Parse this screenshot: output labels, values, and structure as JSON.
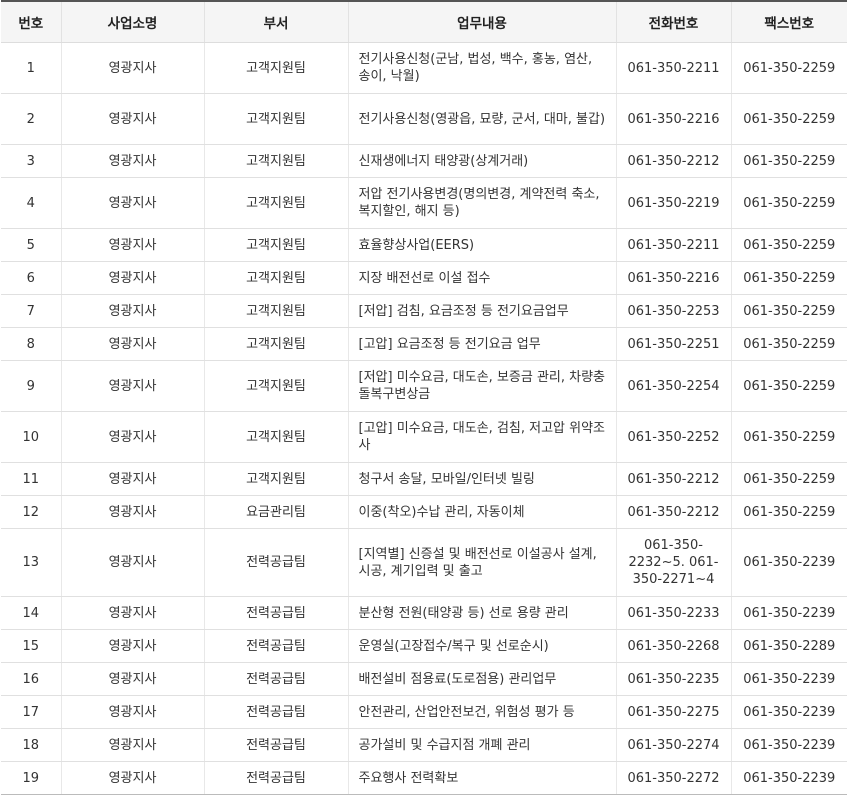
{
  "headers": [
    "번호",
    "사업소명",
    "부서",
    "업무내용",
    "전화번호",
    "팩스번호"
  ],
  "rows": [
    {
      "no": "1",
      "office": "영광지사",
      "dept": "고객지원팀",
      "duty": "전기사용신청(군남, 법성, 백수, 홍농, 염산, 송이, 낙월)",
      "phone": "061-350-2211",
      "fax": "061-350-2259"
    },
    {
      "no": "2",
      "office": "영광지사",
      "dept": "고객지원팀",
      "duty": "전기사용신청(영광읍, 묘량, 군서, 대마, 불갑)",
      "phone": "061-350-2216",
      "fax": "061-350-2259"
    },
    {
      "no": "3",
      "office": "영광지사",
      "dept": "고객지원팀",
      "duty": "신재생에너지 태양광(상계거래)",
      "phone": "061-350-2212",
      "fax": "061-350-2259"
    },
    {
      "no": "4",
      "office": "영광지사",
      "dept": "고객지원팀",
      "duty": "저압 전기사용변경(명의변경, 계약전력 축소, 복지할인, 해지 등)",
      "phone": "061-350-2219",
      "fax": "061-350-2259"
    },
    {
      "no": "5",
      "office": "영광지사",
      "dept": "고객지원팀",
      "duty": "효율향상사업(EERS)",
      "phone": "061-350-2211",
      "fax": "061-350-2259"
    },
    {
      "no": "6",
      "office": "영광지사",
      "dept": "고객지원팀",
      "duty": "지장 배전선로 이설 접수",
      "phone": "061-350-2216",
      "fax": "061-350-2259"
    },
    {
      "no": "7",
      "office": "영광지사",
      "dept": "고객지원팀",
      "duty": "[저압] 검침, 요금조정 등 전기요금업무",
      "phone": "061-350-2253",
      "fax": "061-350-2259"
    },
    {
      "no": "8",
      "office": "영광지사",
      "dept": "고객지원팀",
      "duty": "[고압] 요금조정 등 전기요금 업무",
      "phone": "061-350-2251",
      "fax": "061-350-2259"
    },
    {
      "no": "9",
      "office": "영광지사",
      "dept": "고객지원팀",
      "duty": "[저압] 미수요금, 대도손, 보증금 관리, 차량충돌복구변상금",
      "phone": "061-350-2254",
      "fax": "061-350-2259"
    },
    {
      "no": "10",
      "office": "영광지사",
      "dept": "고객지원팀",
      "duty": "[고압] 미수요금, 대도손, 검침, 저고압 위약조사",
      "phone": "061-350-2252",
      "fax": "061-350-2259"
    },
    {
      "no": "11",
      "office": "영광지사",
      "dept": "고객지원팀",
      "duty": "청구서 송달, 모바일/인터넷 빌링",
      "phone": "061-350-2212",
      "fax": "061-350-2259"
    },
    {
      "no": "12",
      "office": "영광지사",
      "dept": "요금관리팀",
      "duty": "이중(착오)수납 관리, 자동이체",
      "phone": "061-350-2212",
      "fax": "061-350-2259"
    },
    {
      "no": "13",
      "office": "영광지사",
      "dept": "전력공급팀",
      "duty": "[지역별] 신증설 및 배전선로 이설공사 설계, 시공, 계기입력 및 출고",
      "phone": "061-350-2232~5. 061-350-2271~4",
      "fax": "061-350-2239"
    },
    {
      "no": "14",
      "office": "영광지사",
      "dept": "전력공급팀",
      "duty": "분산형 전원(태양광 등) 선로 용량 관리",
      "phone": "061-350-2233",
      "fax": "061-350-2239"
    },
    {
      "no": "15",
      "office": "영광지사",
      "dept": "전력공급팀",
      "duty": "운영실(고장접수/복구 및 선로순시)",
      "phone": "061-350-2268",
      "fax": "061-350-2289"
    },
    {
      "no": "16",
      "office": "영광지사",
      "dept": "전력공급팀",
      "duty": "배전설비 점용료(도로점용) 관리업무",
      "phone": "061-350-2235",
      "fax": "061-350-2239"
    },
    {
      "no": "17",
      "office": "영광지사",
      "dept": "전력공급팀",
      "duty": "안전관리, 산업안전보건, 위험성 평가 등",
      "phone": "061-350-2275",
      "fax": "061-350-2239"
    },
    {
      "no": "18",
      "office": "영광지사",
      "dept": "전력공급팀",
      "duty": "공가설비 및 수급지점 개폐 관리",
      "phone": "061-350-2274",
      "fax": "061-350-2239"
    },
    {
      "no": "19",
      "office": "영광지사",
      "dept": "전력공급팀",
      "duty": "주요행사 전력확보",
      "phone": "061-350-2272",
      "fax": "061-350-2239"
    }
  ]
}
